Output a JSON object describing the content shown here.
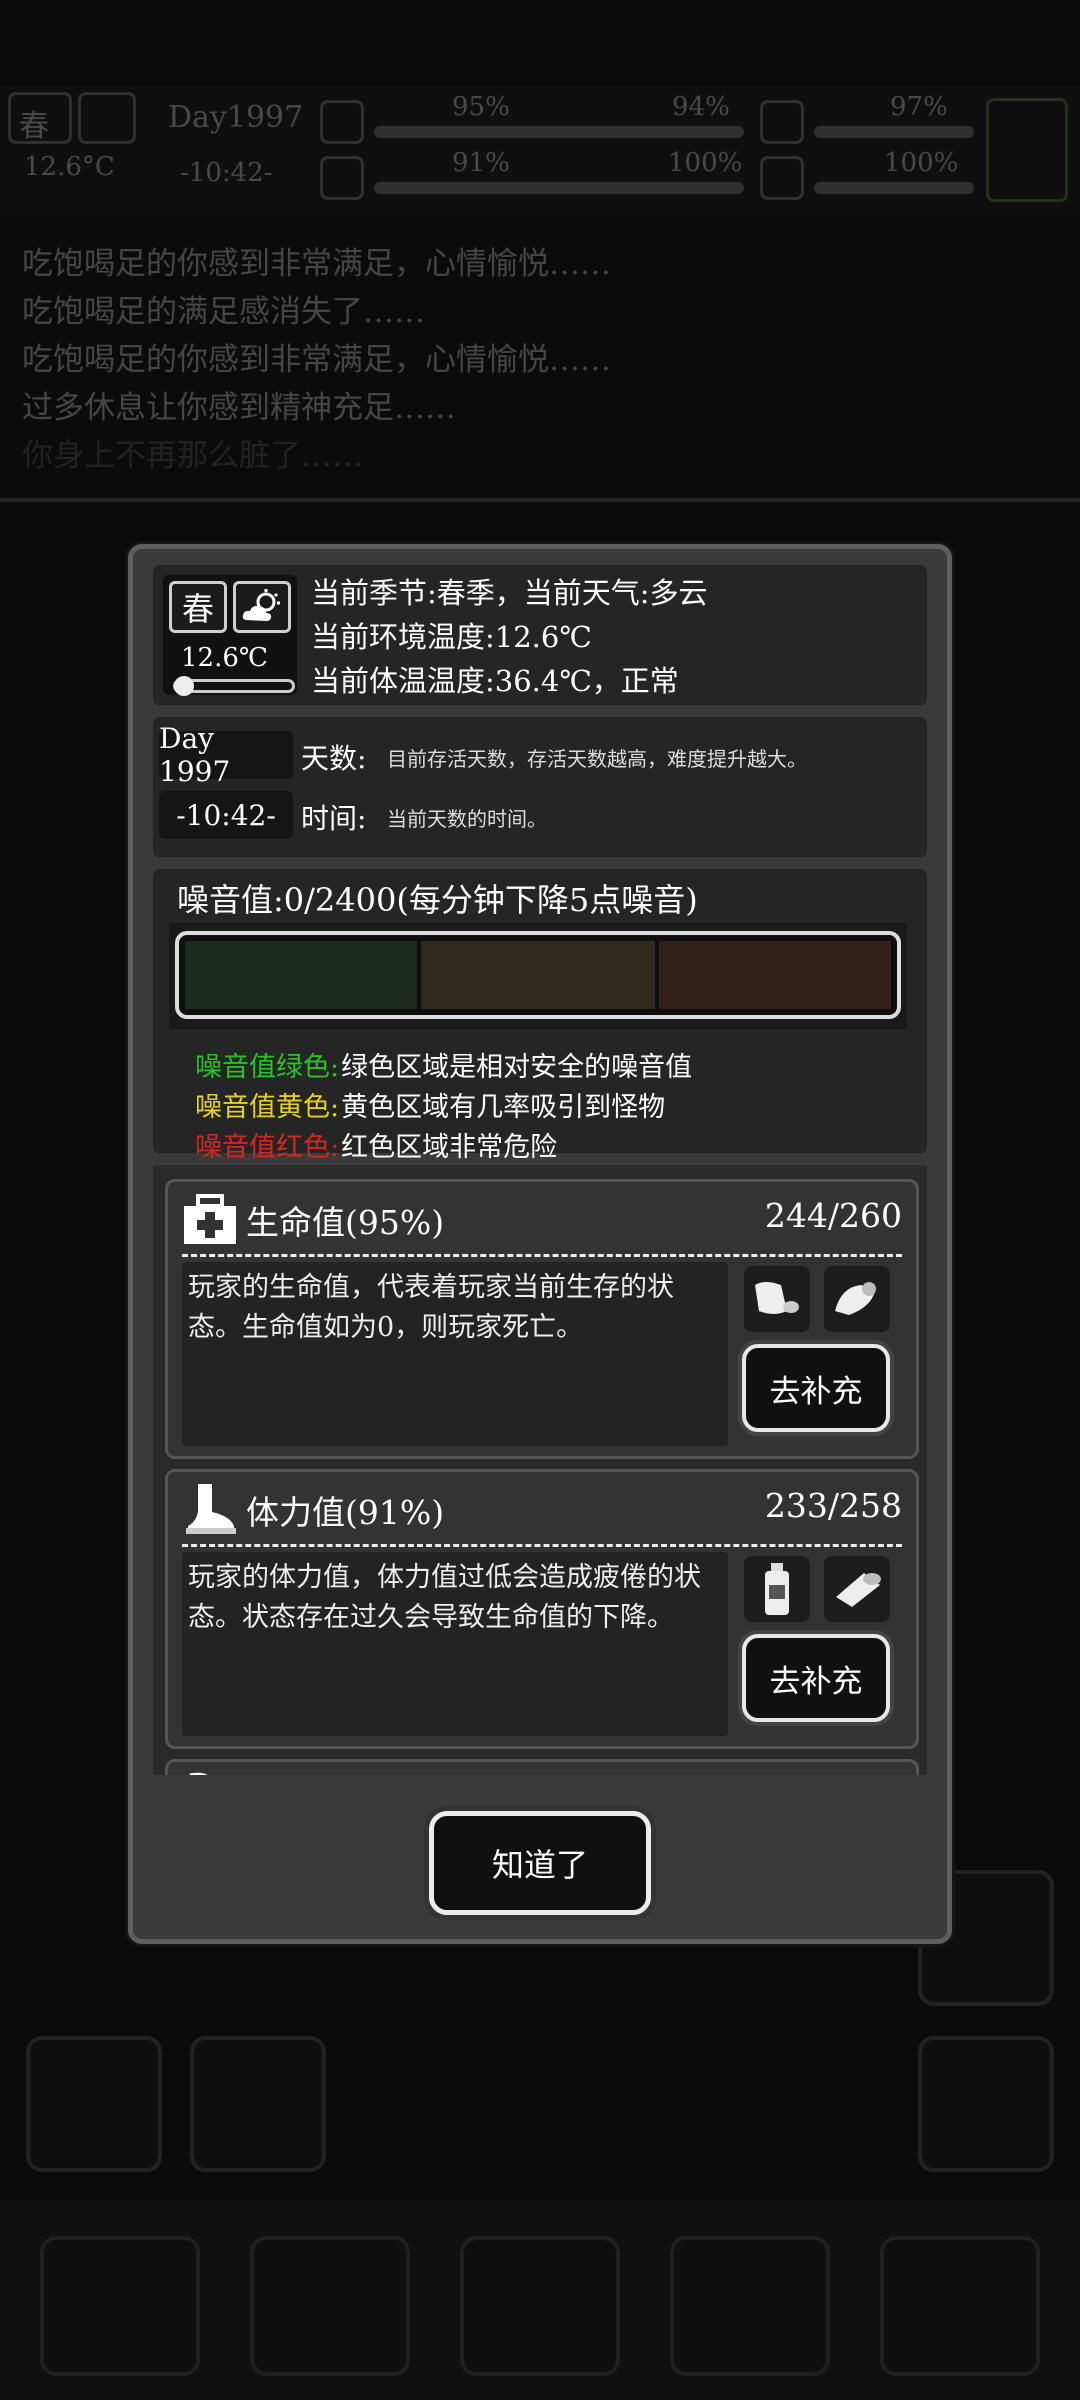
{
  "hud": {
    "season_char": "春",
    "day": "Day1997",
    "time": "-10:42-",
    "temperature": "12.6°C",
    "stats": [
      "95%",
      "94%",
      "97%",
      "91%",
      "100%",
      "100%"
    ]
  },
  "log": [
    "吃饱喝足的你感到非常满足，心情愉悦……",
    "吃饱喝足的满足感消失了……",
    "吃饱喝足的你感到非常满足，心情愉悦……",
    "过多休息让你感到精神充足……",
    "你身上不再那么脏了……"
  ],
  "modal": {
    "season_char": "春",
    "temperature": "12.6℃",
    "season_line": "当前季节:春季，当前天气:多云",
    "env_temp_line": "当前环境温度:12.6℃",
    "body_temp_line": "当前体温温度:36.4℃，正常",
    "day_value": "Day 1997",
    "day_label": "天数:",
    "day_desc": "目前存活天数，存活天数越高，难度提升越大。",
    "time_value": "-10:42-",
    "time_label": "时间:",
    "time_desc": "当前天数的时间。",
    "noise_title": "噪音值:0/2400(每分钟下降5点噪音)",
    "noise_value": 0,
    "noise_max": 2400,
    "legend": [
      {
        "key": "噪音值绿色:",
        "text": "绿色区域是相对安全的噪音值",
        "color": "#27c427"
      },
      {
        "key": "噪音值黄色:",
        "text": "黄色区域有几率吸引到怪物",
        "color": "#e5d21f"
      },
      {
        "key": "噪音值红色:",
        "text": "红色区域非常危险",
        "color": "#d4271f"
      }
    ],
    "cards": [
      {
        "title": "生命值(95%)",
        "value": "244/260",
        "desc": "玩家的生命值，代表着玩家当前生存的状态。生命值如为0，则玩家死亡。",
        "button": "去补充"
      },
      {
        "title": "体力值(91%)",
        "value": "233/258",
        "desc": "玩家的体力值，体力值过低会造成疲倦的状态。状态存在过久会导致生命值的下降。",
        "button": "去补充"
      }
    ],
    "ok_button": "知道了"
  },
  "colors": {
    "noise_green": "#1f2a1f",
    "noise_yellow": "#2e2a1c",
    "noise_red": "#33201d"
  }
}
